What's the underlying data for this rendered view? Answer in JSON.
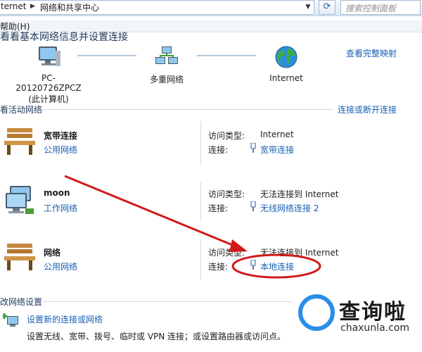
{
  "address": {
    "crumb1": "ternet",
    "crumb2": "网络和共享中心",
    "search_placeholder": "搜索控制面板"
  },
  "menu": {
    "help": "帮助(H)"
  },
  "header": {
    "title": "看看基本网络信息并设置连接",
    "map_link": "查看完整映射",
    "nodes": [
      {
        "label": "PC-20120726ZPCZ",
        "sub": "(此计算机)"
      },
      {
        "label": "多重网络",
        "sub": ""
      },
      {
        "label": "Internet",
        "sub": ""
      }
    ]
  },
  "active": {
    "title": "看活动网络",
    "link": "连接或断开连接",
    "networks": [
      {
        "name": "宽带连接",
        "category": "公用网络",
        "access_label": "访问类型:",
        "access": "Internet",
        "conn_label": "连接:",
        "conn": "宽带连接"
      },
      {
        "name": "moon",
        "category": "工作网络",
        "access_label": "访问类型:",
        "access": "无法连接到 Internet",
        "conn_label": "连接:",
        "conn": "无线网络连接 2"
      },
      {
        "name": "网络",
        "category": "公用网络",
        "access_label": "访问类型:",
        "access": "无法连接到 Internet",
        "conn_label": "连接:",
        "conn": "本地连接"
      }
    ]
  },
  "settings": {
    "title": "改网络设置",
    "new_conn_link": "设置新的连接或网络",
    "new_conn_desc": "设置无线、宽带、拨号、临时或 VPN 连接；或设置路由器或访问点。"
  },
  "watermark": {
    "brand": "查询啦",
    "domain": "chaxunla.com"
  },
  "colors": {
    "link": "#1a5fb4",
    "annotation": "#d11a1a",
    "watermark_blue": "#2a8ee8"
  }
}
